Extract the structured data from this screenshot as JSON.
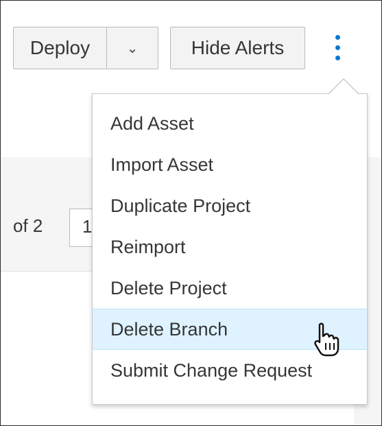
{
  "toolbar": {
    "deploy_label": "Deploy",
    "deploy_caret": "⌄",
    "hide_alerts_label": "Hide Alerts"
  },
  "pagination": {
    "of_label": "of 2",
    "current_page": "1"
  },
  "menu": {
    "items": [
      {
        "label": "Add Asset"
      },
      {
        "label": "Import Asset"
      },
      {
        "label": "Duplicate Project"
      },
      {
        "label": "Reimport"
      },
      {
        "label": "Delete Project"
      },
      {
        "label": "Delete Branch",
        "highlighted": true
      },
      {
        "label": "Submit Change Request"
      }
    ]
  },
  "colors": {
    "kebab": "#0a78d1",
    "highlight": "#def3ff"
  },
  "icons": {
    "kebab": "kebab-icon",
    "caret": "chevron-down-icon",
    "cursor": "hand-pointer-icon"
  }
}
